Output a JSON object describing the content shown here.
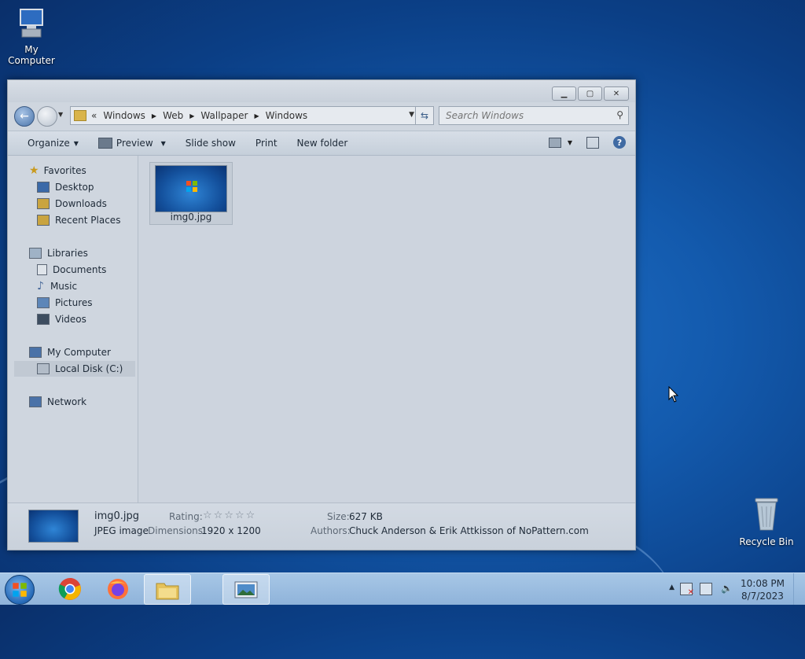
{
  "desktop": {
    "icons": [
      {
        "label": "My Computer"
      },
      {
        "label": "Recycle Bin"
      }
    ]
  },
  "window": {
    "address": {
      "overflow": "«",
      "crumbs": [
        "Windows",
        "Web",
        "Wallpaper",
        "Windows"
      ]
    },
    "search_placeholder": "Search Windows",
    "toolbar": {
      "organize": "Organize",
      "preview": "Preview",
      "slideshow": "Slide show",
      "print": "Print",
      "new_folder": "New folder"
    },
    "nav": {
      "favorites": "Favorites",
      "desktop": "Desktop",
      "downloads": "Downloads",
      "recent": "Recent Places",
      "libraries": "Libraries",
      "documents": "Documents",
      "music": "Music",
      "pictures": "Pictures",
      "videos": "Videos",
      "computer": "My Computer",
      "localdisk": "Local Disk (C:)",
      "network": "Network"
    },
    "files": [
      {
        "name": "img0.jpg"
      }
    ],
    "details": {
      "name": "img0.jpg",
      "type": "JPEG image",
      "rating_label": "Rating:",
      "dimensions_label": "Dimensions:",
      "dimensions": "1920 x 1200",
      "size_label": "Size:",
      "size": "627 KB",
      "authors_label": "Authors:",
      "authors": "Chuck Anderson & Erik Attkisson of NoPattern.com",
      "rating_stars": "☆☆☆☆☆"
    }
  },
  "taskbar": {
    "time": "10:08 PM",
    "date": "8/7/2023",
    "apps": [
      "start",
      "chrome",
      "firefox",
      "file-explorer",
      "photo-viewer"
    ]
  }
}
